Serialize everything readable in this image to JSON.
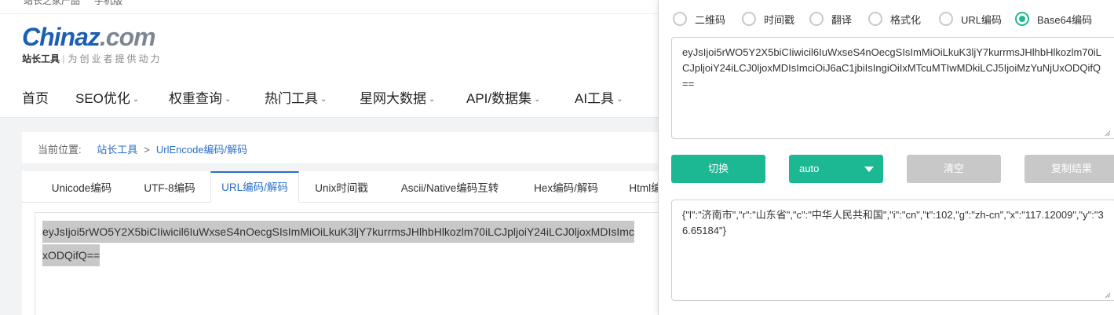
{
  "topbar": {
    "left_text": "站长之家产品",
    "right_text": "手机版"
  },
  "logo": {
    "name_main": "Chinaz",
    "name_suffix": ".com",
    "tool_label": "站长工具",
    "slogan": "为创业者提供动力"
  },
  "nav": [
    {
      "label": "首页",
      "has_dropdown": false
    },
    {
      "label": "SEO优化",
      "has_dropdown": true
    },
    {
      "label": "权重查询",
      "has_dropdown": true
    },
    {
      "label": "热门工具",
      "has_dropdown": true
    },
    {
      "label": "星网大数据",
      "has_dropdown": true
    },
    {
      "label": "API/数据集",
      "has_dropdown": true
    },
    {
      "label": "AI工具",
      "has_dropdown": true
    }
  ],
  "breadcrumb": {
    "prefix": "当前位置:",
    "items": [
      "站长工具",
      "UrlEncode编码/解码"
    ],
    "separator": ">"
  },
  "tabs": [
    {
      "label": "Unicode编码"
    },
    {
      "label": "UTF-8编码"
    },
    {
      "label": "URL编码/解码",
      "active": true
    },
    {
      "label": "Unix时间戳"
    },
    {
      "label": "Ascii/Native编码互转"
    },
    {
      "label": "Hex编码/解码"
    },
    {
      "label": "Html编"
    }
  ],
  "editor": {
    "line1": "eyJsIjoi5rWO5Y2X5biCIiwicil6IuWxseS4nOecgSIsImMiOiLkuK3ljY7kurrmsJHlhbHlkozlm70iLCJpljoiY24iLCJ0ljoxMDIsImc",
    "line2": "xODQifQ=="
  },
  "popup": {
    "radios": [
      {
        "label": "二维码",
        "checked": false
      },
      {
        "label": "时间戳",
        "checked": false
      },
      {
        "label": "翻译",
        "checked": false
      },
      {
        "label": "格式化",
        "checked": false
      },
      {
        "label": "URL编码",
        "checked": false
      },
      {
        "label": "Base64编码",
        "checked": true
      }
    ],
    "input_text": "eyJsIjoi5rWO5Y2X5biCIiwicil6IuWxseS4nOecgSIsImMiOiLkuK3ljY7kurrmsJHlhbHlkozlm70iLCJpljoiY24iLCJ0ljoxMDIsImciOiJ6aC1jbiIsIngiOiIxMTcuMTIwMDkiLCJ5IjoiMzYuNjUxODQifQ==",
    "buttons": {
      "switch": "切换",
      "select_value": "auto",
      "clear": "清空",
      "copy": "复制结果"
    },
    "output_text": "{\"l\":\"济南市\",\"r\":\"山东省\",\"c\":\"中华人民共和国\",\"i\":\"cn\",\"t\":102,\"g\":\"zh-cn\",\"x\":\"117.12009\",\"y\":\"36.65184\"}"
  },
  "colors": {
    "accent_green": "#1cb894",
    "link_blue": "#2a6fc9",
    "logo_blue": "#1b5fb5",
    "disabled_gray": "#c8c8c8"
  }
}
